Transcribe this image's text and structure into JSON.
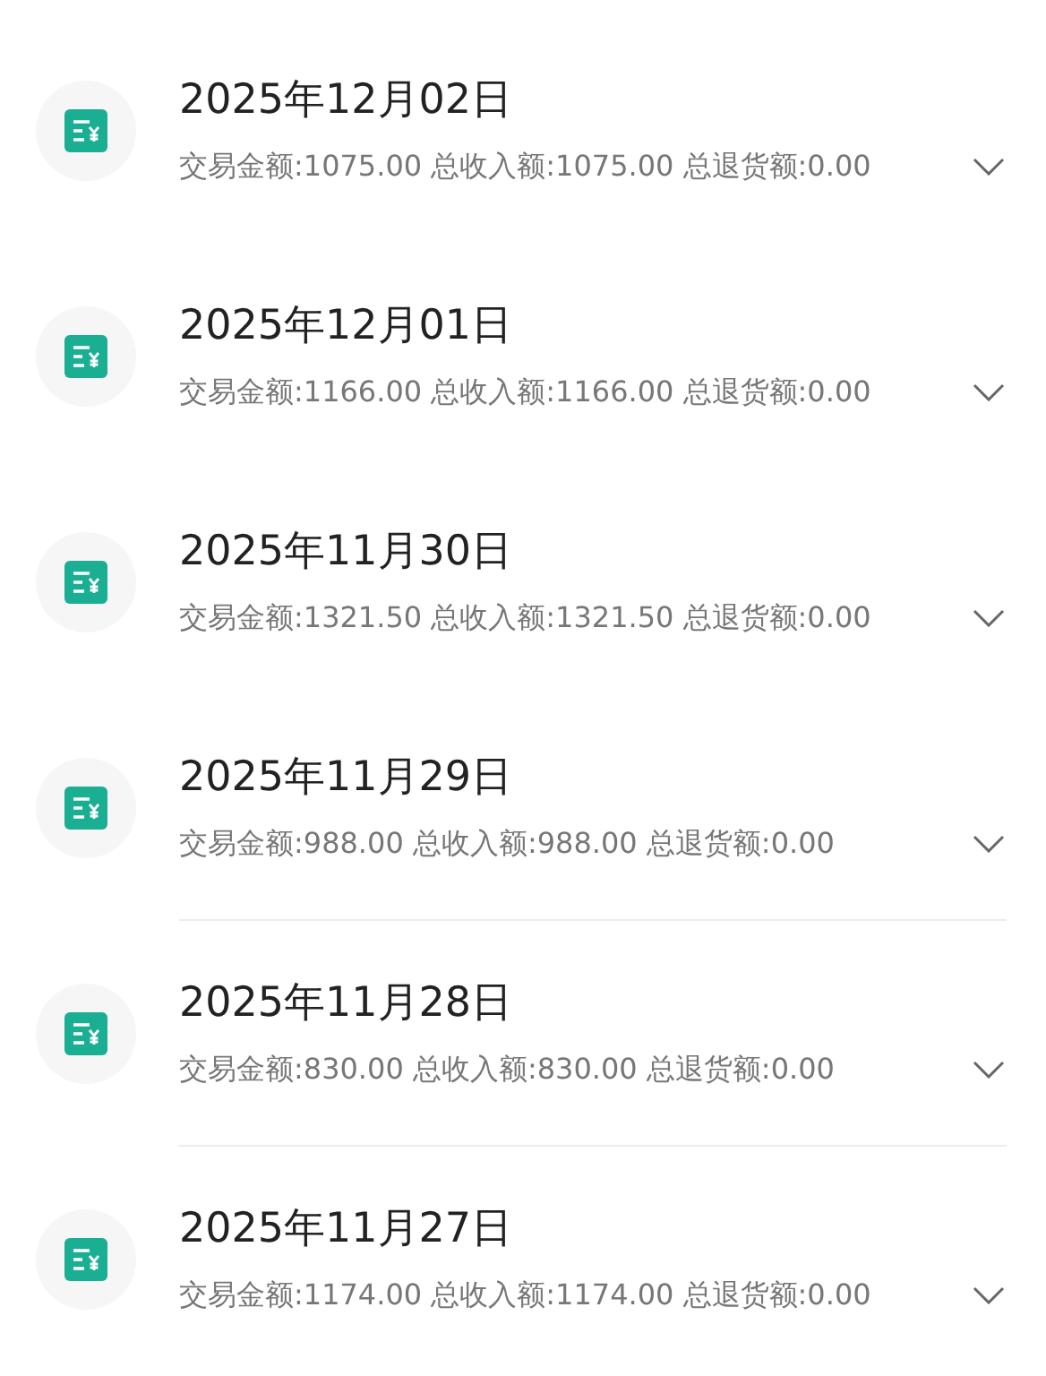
{
  "records": [
    {
      "date": "2025年12月02日",
      "summary": "交易金额:1075.00 总收入额:1075.00 总退货额:0.00",
      "divider": false
    },
    {
      "date": "2025年12月01日",
      "summary": "交易金额:1166.00 总收入额:1166.00 总退货额:0.00",
      "divider": false
    },
    {
      "date": "2025年11月30日",
      "summary": "交易金额:1321.50 总收入额:1321.50 总退货额:0.00",
      "divider": false
    },
    {
      "date": "2025年11月29日",
      "summary": "交易金额:988.00 总收入额:988.00 总退货额:0.00",
      "divider": true
    },
    {
      "date": "2025年11月28日",
      "summary": "交易金额:830.00 总收入额:830.00 总退货额:0.00",
      "divider": true
    },
    {
      "date": "2025年11月27日",
      "summary": "交易金额:1174.00 总收入额:1174.00 总退货额:0.00",
      "divider": false
    }
  ]
}
